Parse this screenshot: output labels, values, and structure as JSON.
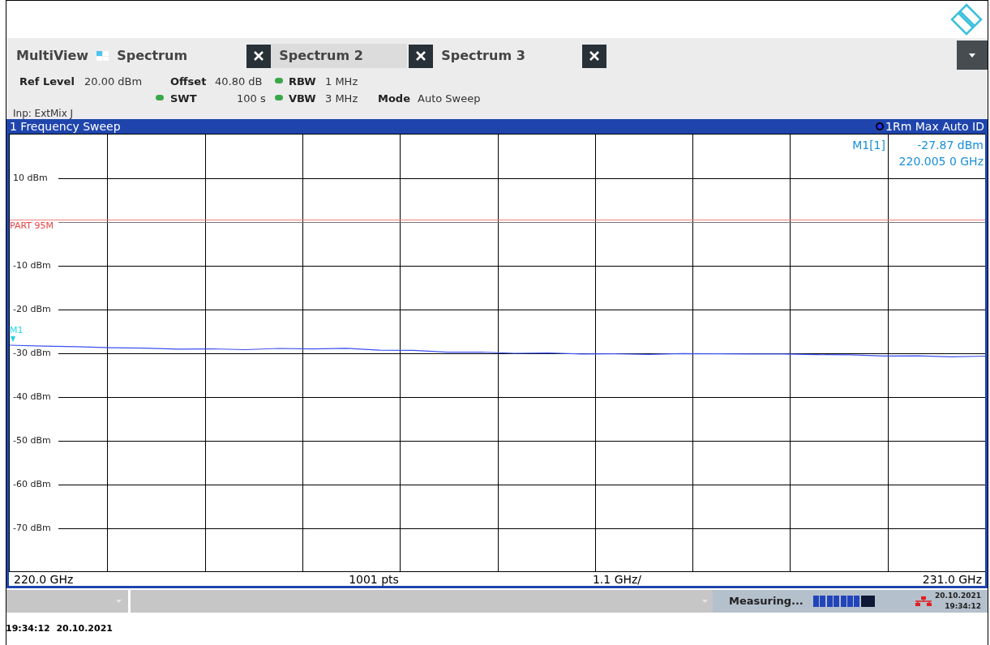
{
  "tabs": [
    {
      "label": "MultiView",
      "kind": "multiview",
      "selected": false
    },
    {
      "label": "Spectrum",
      "kind": "channel",
      "selected": false
    },
    {
      "label": "Spectrum 2",
      "kind": "channel",
      "selected": true
    },
    {
      "label": "Spectrum 3",
      "kind": "channel",
      "selected": false
    }
  ],
  "settings": {
    "ref_level_label": "Ref Level",
    "ref_level": "20.00 dBm",
    "offset_label": "Offset",
    "offset": "40.80 dB",
    "rbw_label": "RBW",
    "rbw": "1 MHz",
    "swt_label": "SWT",
    "swt": "100 s",
    "vbw_label": "VBW",
    "vbw": "3 MHz",
    "mode_label": "Mode",
    "mode": "Auto Sweep",
    "input": "Inp: ExtMix J"
  },
  "window": {
    "title": "1 Frequency Sweep",
    "trace_info": "1Rm Max Auto ID"
  },
  "marker": {
    "label": "M1[1]",
    "level": "-27.87 dBm",
    "frequency": "220.005 0 GHz",
    "tag": "M1"
  },
  "y_labels": [
    "10 dBm",
    "-10 dBm",
    "-20 dBm",
    "-30 dBm",
    "-40 dBm",
    "-50 dBm",
    "-60 dBm",
    "-70 dBm"
  ],
  "limit_line": "PART 95M",
  "x_axis": {
    "start": "220.0 GHz",
    "points": "1001 pts",
    "span": "1.1 GHz/",
    "stop": "231.0 GHz"
  },
  "status_bar": {
    "state": "Measuring...",
    "progress": {
      "level": 0.78
    },
    "date": "20.10.2021",
    "time": "19:34:12"
  },
  "footer": "19:34:12  20.10.2021"
}
